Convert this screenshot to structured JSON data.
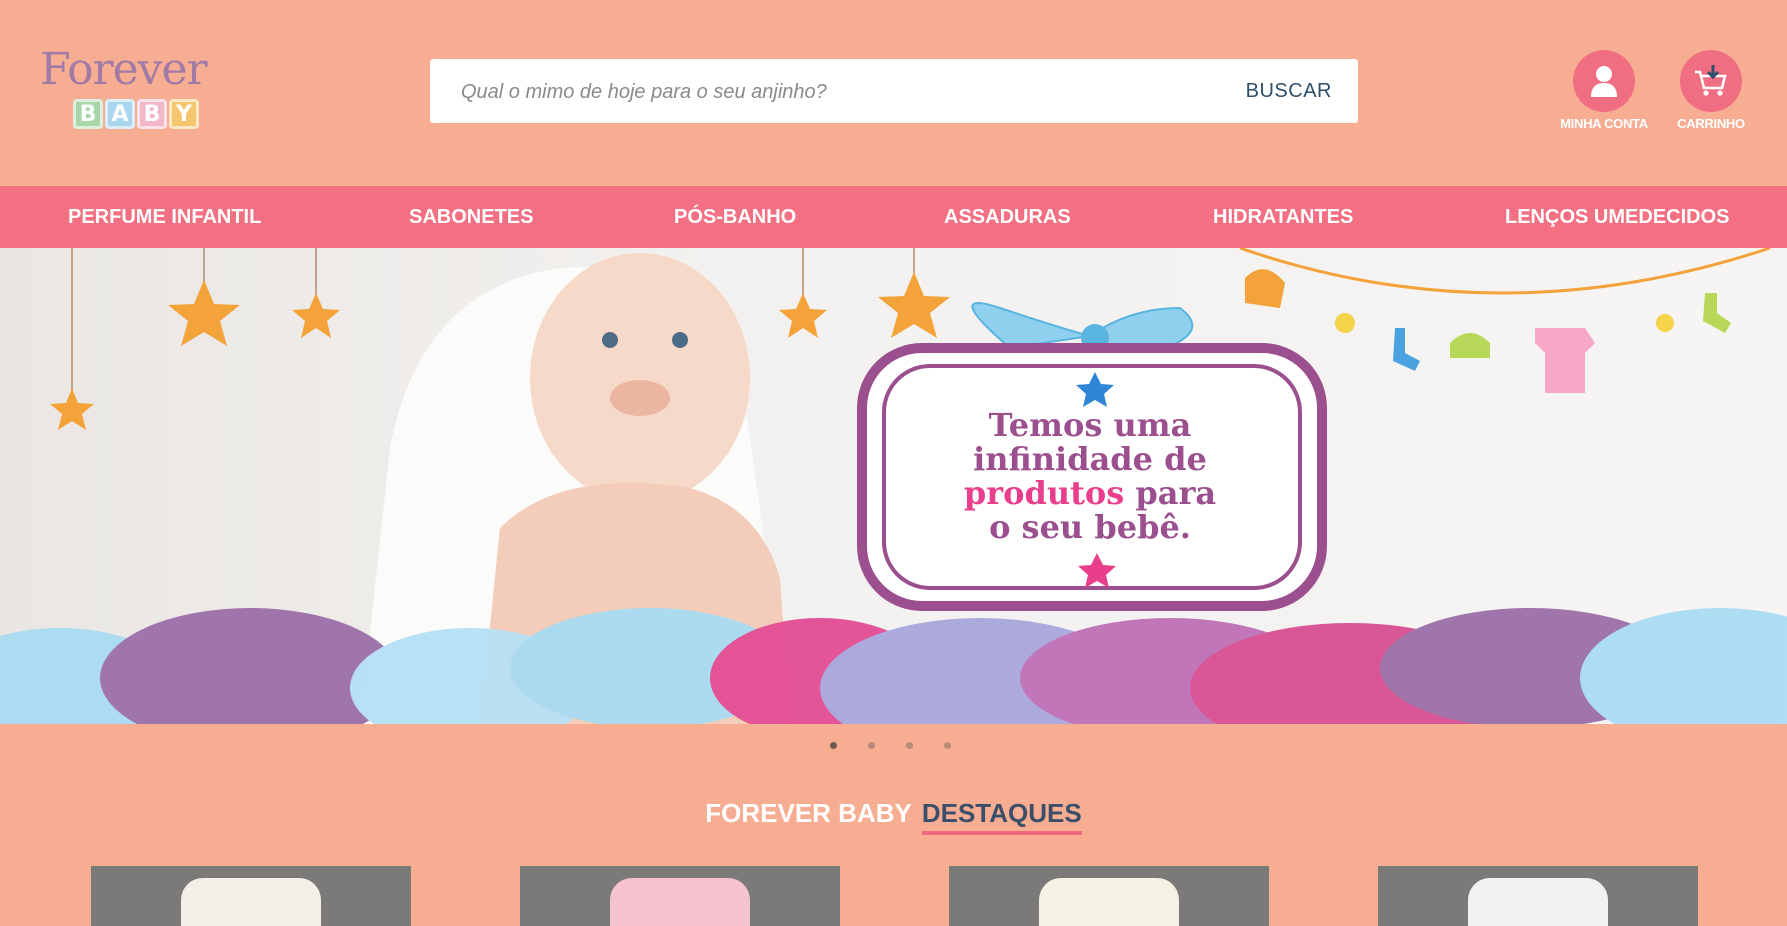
{
  "header": {
    "logo": {
      "line1": "Forever",
      "line2": [
        "B",
        "A",
        "B",
        "Y"
      ],
      "block_colors": [
        "#a8d8a8",
        "#a9d6ee",
        "#f3b6c8",
        "#f4c66e"
      ]
    },
    "search": {
      "placeholder": "Qual o mimo de hoje para o seu anjinho?",
      "button_label": "BUSCAR"
    },
    "account": {
      "label": "MINHA CONTA",
      "icon": "user-icon"
    },
    "cart": {
      "label": "CARRINHO",
      "icon": "cart-icon"
    }
  },
  "nav": {
    "items": [
      {
        "label": "PERFUME INFANTIL"
      },
      {
        "label": "SABONETES"
      },
      {
        "label": "PÓS-BANHO"
      },
      {
        "label": "ASSADURAS"
      },
      {
        "label": "HIDRATANTES"
      },
      {
        "label": "LENÇOS UMEDECIDOS"
      }
    ]
  },
  "banner": {
    "text_lines": [
      "Temos uma",
      "infinidade de",
      "produtos",
      "para",
      "o seu bebê."
    ],
    "slide_count": 4,
    "active_slide": 1
  },
  "featured": {
    "title_part1": "FOREVER BABY",
    "title_part2": "DESTAQUES"
  },
  "colors": {
    "background": "#f6ad92",
    "nav": "#f36f82",
    "accent": "#f06e82",
    "title_dark": "#3b4f6b",
    "banner_purple": "#9b4f8e",
    "banner_pink": "#e83e8c"
  }
}
